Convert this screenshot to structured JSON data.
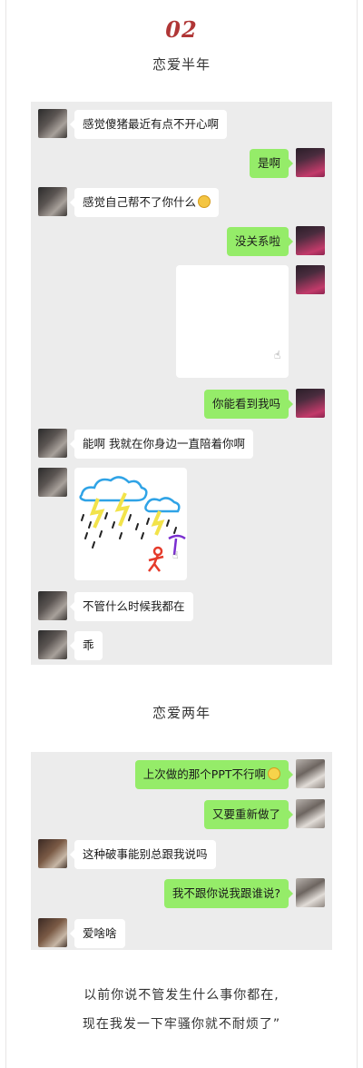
{
  "section1": {
    "number": "02",
    "title": "恋爱半年",
    "messages": {
      "m1": "感觉傻猪最近有点不开心啊",
      "m2": "是啊",
      "m3": "感觉自己帮不了你什么",
      "m4": "没关系啦",
      "m5": "你能看到我吗",
      "m6": "能啊 我就在你身边一直陪着你啊",
      "m7": "不管什么时候我都在",
      "m8": "乖"
    }
  },
  "section2": {
    "title": "恋爱两年",
    "messages": {
      "m1": "上次做的那个PPT不行啊",
      "m2": "又要重新做了",
      "m3": "这种破事能别总跟我说吗",
      "m4": "我不跟你说我跟谁说?",
      "m5": "爱啥啥"
    }
  },
  "footer": {
    "line1": "以前你说不管发生什么事你都在,",
    "line2": "现在我发一下牢骚你就不耐烦了”"
  },
  "colors": {
    "accent": "#b03636",
    "bubble_green": "#95ec69",
    "panel_gray": "#ececec"
  },
  "icons": {
    "emoji_1": "worried-face-emoji",
    "emoji_2": "crying-face-emoji"
  }
}
